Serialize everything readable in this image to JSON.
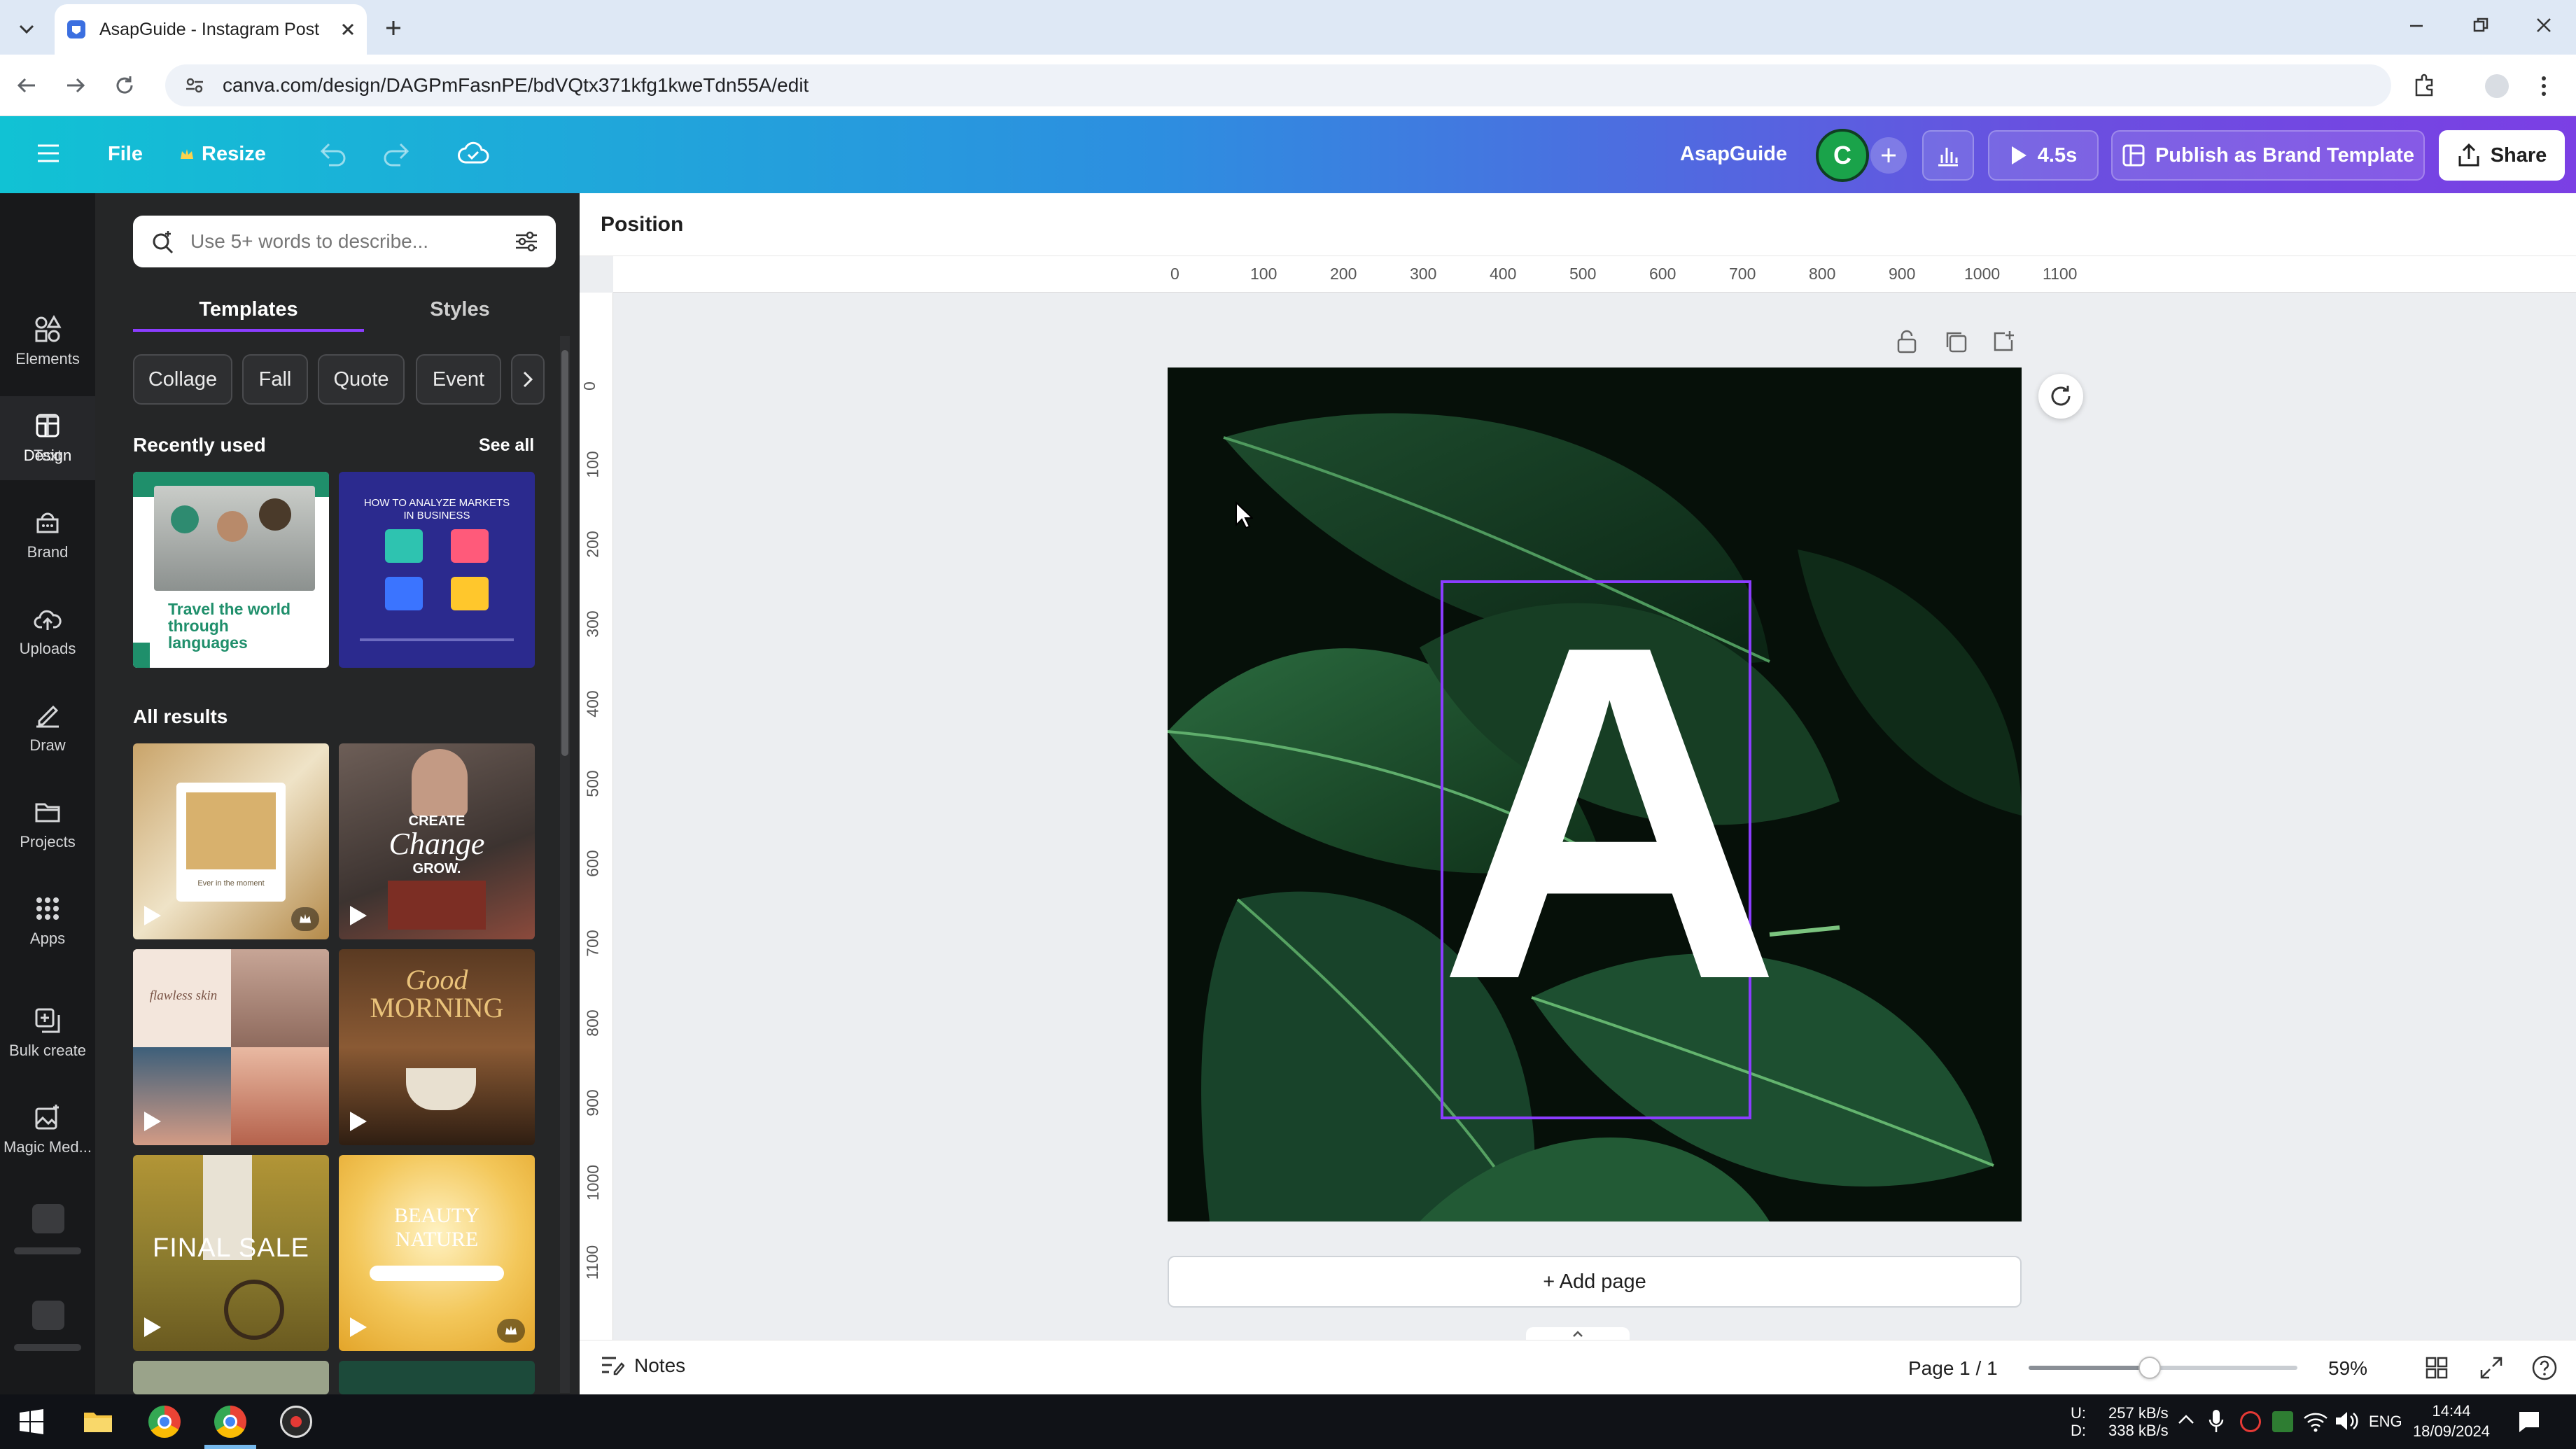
{
  "browser": {
    "tab_title": "AsapGuide - Instagram Post",
    "url": "canva.com/design/DAGPmFasnPE/bdVQtx371kfg1kweTdn55A/edit"
  },
  "header": {
    "file_label": "File",
    "resize_label": "Resize",
    "brand_name": "AsapGuide",
    "avatar_letter": "C",
    "play_duration": "4.5s",
    "publish_label": "Publish as Brand Template",
    "share_label": "Share"
  },
  "rail": [
    {
      "label": "Design"
    },
    {
      "label": "Elements"
    },
    {
      "label": "Text"
    },
    {
      "label": "Brand"
    },
    {
      "label": "Uploads"
    },
    {
      "label": "Draw"
    },
    {
      "label": "Projects"
    },
    {
      "label": "Apps"
    },
    {
      "label": "Bulk create"
    },
    {
      "label": "Magic Med..."
    }
  ],
  "panel": {
    "search_placeholder": "Use 5+ words to describe...",
    "tabs": [
      "Templates",
      "Styles"
    ],
    "chips": [
      "Collage",
      "Fall",
      "Quote",
      "Event"
    ],
    "recently_used_title": "Recently used",
    "see_all_label": "See all",
    "all_results_title": "All results",
    "recent": [
      {
        "caption": "Travel the world through languages"
      },
      {
        "caption": "HOW TO ANALYZE MARKETS IN BUSINESS"
      }
    ],
    "results": [
      {
        "caption": "Ever in the moment"
      },
      {
        "caption_top": "CREATE",
        "caption_mid": "Change",
        "caption_bot": "GROW."
      },
      {
        "caption": "flawless skin"
      },
      {
        "caption_top": "Good",
        "caption_bot": "MORNING"
      },
      {
        "caption": "FINAL SALE"
      },
      {
        "caption_top": "BEAUTY",
        "caption_bot": "NATURE"
      }
    ]
  },
  "editor": {
    "position_label": "Position",
    "ruler_h": [
      "0",
      "100",
      "200",
      "300",
      "400",
      "500",
      "600",
      "700",
      "800",
      "900",
      "1000",
      "1100"
    ],
    "ruler_v": [
      "0",
      "100",
      "200",
      "300",
      "400",
      "500",
      "600",
      "700",
      "800",
      "900",
      "1000",
      "1100"
    ],
    "canvas_letter": "A",
    "add_page_label": "+ Add page",
    "notes_label": "Notes",
    "page_indicator": "Page 1 / 1",
    "zoom_percent": "59%",
    "zoom_fraction": 0.45
  },
  "taskbar": {
    "net_up": "257 kB/s",
    "net_down": "338 kB/s",
    "net_up_label": "U:",
    "net_down_label": "D:",
    "lang": "ENG",
    "time": "14:44",
    "date": "18/09/2024"
  },
  "colors": {
    "canva_gradient_start": "#11c2d4",
    "canva_gradient_end": "#7b3fe4",
    "selection": "#8b3dff",
    "avatar_green": "#1aa34a"
  }
}
